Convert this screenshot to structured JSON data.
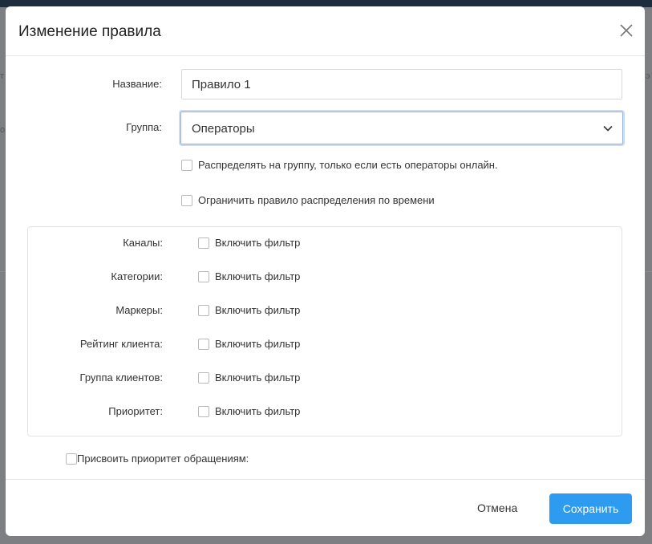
{
  "dialog": {
    "title": "Изменение правила",
    "close_icon": "close-icon"
  },
  "form": {
    "name": {
      "label": "Название:",
      "value": "Правило 1"
    },
    "group": {
      "label": "Группа:",
      "value": "Операторы",
      "icon": "chevron-down-icon"
    },
    "distribute_online": {
      "label": "Распределять на группу, только если есть операторы онлайн.",
      "checked": false
    },
    "time_limit": {
      "label": "Ограничить правило распределения по времени",
      "checked": false
    },
    "filters": [
      {
        "label": "Каналы:",
        "toggle_label": "Включить фильтр",
        "checked": false
      },
      {
        "label": "Категории:",
        "toggle_label": "Включить фильтр",
        "checked": false
      },
      {
        "label": "Маркеры:",
        "toggle_label": "Включить фильтр",
        "checked": false
      },
      {
        "label": "Рейтинг клиента:",
        "toggle_label": "Включить фильтр",
        "checked": false
      },
      {
        "label": "Группа клиентов:",
        "toggle_label": "Включить фильтр",
        "checked": false
      },
      {
        "label": "Приоритет:",
        "toggle_label": "Включить фильтр",
        "checked": false
      }
    ],
    "assign_priority": {
      "label": "Присвоить приоритет обращениям:",
      "checked": false
    }
  },
  "footer": {
    "cancel_label": "Отмена",
    "save_label": "Сохранить"
  },
  "colors": {
    "primary": "#2d9cf0",
    "overlay": "#7d7f82",
    "focus_ring": "#c8dcf5"
  }
}
